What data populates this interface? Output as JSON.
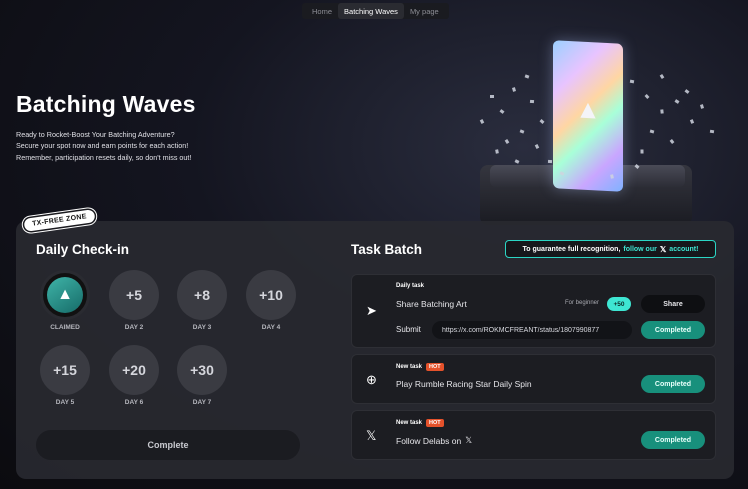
{
  "nav": {
    "items": [
      "Home",
      "Batching Waves",
      "My page"
    ],
    "active_index": 1
  },
  "hero": {
    "title": "Batching Waves",
    "desc_line1": "Ready to Rocket-Boost Your Batching Adventure?",
    "desc_line2": "Secure your spot now and earn points for each action!",
    "desc_line3": "Remember, participation resets daily, so don't miss out!"
  },
  "art": {
    "card_logo_icon": "batching-logo-icon"
  },
  "checkin": {
    "badge": "TX-FREE ZONE",
    "title": "Daily Check-in",
    "days": [
      {
        "value": "",
        "label": "CLAIMED",
        "claimed": true
      },
      {
        "value": "+5",
        "label": "DAY 2"
      },
      {
        "value": "+8",
        "label": "DAY 3"
      },
      {
        "value": "+10",
        "label": "DAY 4"
      },
      {
        "value": "+15",
        "label": "DAY 5"
      },
      {
        "value": "+20",
        "label": "DAY 6"
      },
      {
        "value": "+30",
        "label": "DAY 7"
      }
    ],
    "complete_label": "Complete"
  },
  "tasks": {
    "title": "Task Batch",
    "recognition": {
      "prefix": "To guarantee full recognition,",
      "link": "follow our",
      "icon": "x-logo-icon",
      "suffix": "account!"
    },
    "items": [
      {
        "tag": "Daily task",
        "name": "Share Batching Art",
        "icon": "send-icon",
        "beginner": "For beginner",
        "points": "+50",
        "share_label": "Share",
        "submit_label": "Submit",
        "url_value": "https://x.com/ROKMCFREANT/status/1807990877",
        "status_label": "Completed"
      },
      {
        "tag": "New task",
        "hot": "HOT",
        "name": "Play Rumble Racing Star Daily Spin",
        "icon": "globe-icon",
        "status_label": "Completed"
      },
      {
        "tag": "New task",
        "hot": "HOT",
        "name": "Follow Delabs on",
        "name_icon": "x-logo-icon",
        "icon": "x-logo-icon",
        "status_label": "Completed"
      }
    ]
  },
  "colors": {
    "accent": "#3ee6d3",
    "completed_green": "#18907c",
    "hot": "#e5522b",
    "panel": "#28292f"
  }
}
